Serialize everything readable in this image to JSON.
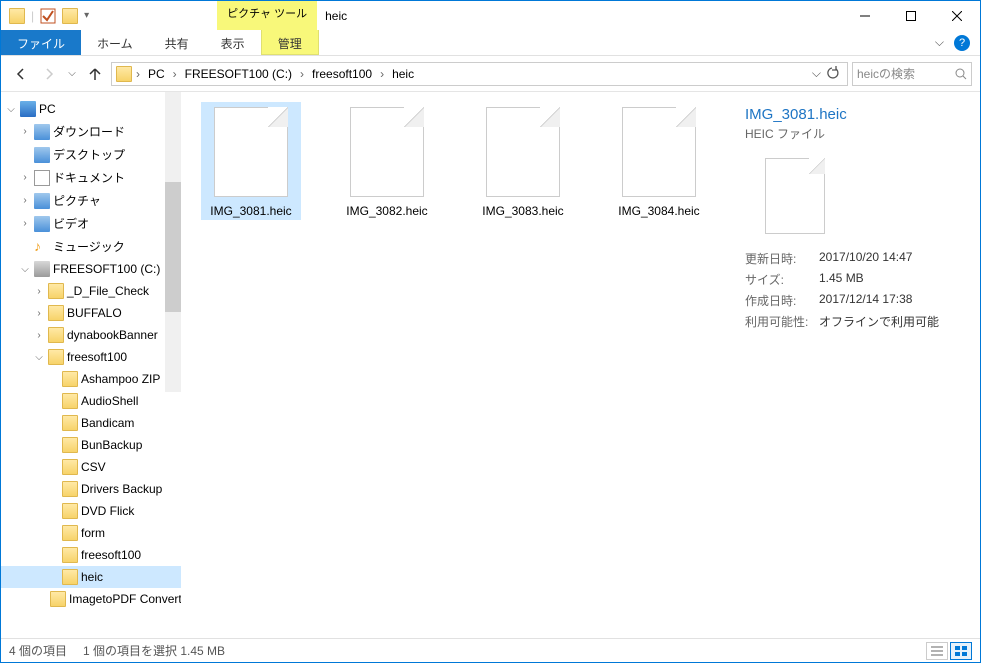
{
  "window": {
    "tool_context": "ピクチャ ツール",
    "title": "heic"
  },
  "ribbon": {
    "file": "ファイル",
    "tabs": {
      "home": "ホーム",
      "share": "共有",
      "view": "表示",
      "manage": "管理"
    }
  },
  "breadcrumb": {
    "items": {
      "pc": "PC",
      "drive": "FREESOFT100 (C:)",
      "folder1": "freesoft100",
      "folder2": "heic"
    }
  },
  "search": {
    "placeholder": "heicの検索"
  },
  "tree": {
    "pc": "PC",
    "downloads": "ダウンロード",
    "desktop": "デスクトップ",
    "documents": "ドキュメント",
    "pictures": "ピクチャ",
    "videos": "ビデオ",
    "music": "ミュージック",
    "drive": "FREESOFT100 (C:)",
    "folders": {
      "d_file_check": "_D_File_Check",
      "buffalo": "BUFFALO",
      "dynabook": "dynabookBanner",
      "freesoft100": "freesoft100",
      "ashampoo": "Ashampoo ZIP",
      "audioshell": "AudioShell",
      "bandicam": "Bandicam",
      "bunbackup": "BunBackup",
      "csv": "CSV",
      "drivers": "Drivers Backup",
      "dvdflick": "DVD Flick",
      "form": "form",
      "freesoft100_sub": "freesoft100",
      "heic": "heic",
      "imagetopdf": "ImagetoPDF Convert"
    }
  },
  "files": [
    {
      "name": "IMG_3081.heic"
    },
    {
      "name": "IMG_3082.heic"
    },
    {
      "name": "IMG_3083.heic"
    },
    {
      "name": "IMG_3084.heic"
    }
  ],
  "details": {
    "title": "IMG_3081.heic",
    "type": "HEIC ファイル",
    "rows": {
      "modified_label": "更新日時:",
      "modified_value": "2017/10/20 14:47",
      "size_label": "サイズ:",
      "size_value": "1.45 MB",
      "created_label": "作成日時:",
      "created_value": "2017/12/14 17:38",
      "availability_label": "利用可能性:",
      "availability_value": "オフラインで利用可能"
    }
  },
  "status": {
    "count": "4 個の項目",
    "selection": "1 個の項目を選択 1.45 MB"
  }
}
